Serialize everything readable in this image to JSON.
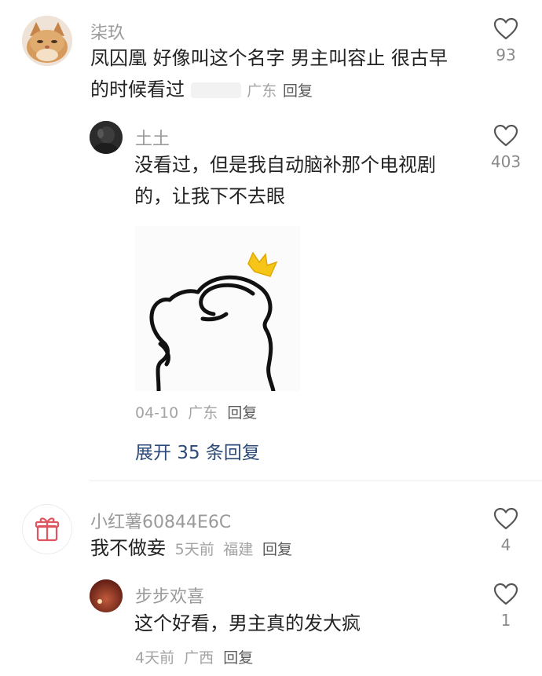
{
  "comments": [
    {
      "username": "柒玖",
      "text_line1": "凤囚凰 好像叫这个名字 男主叫容止 很古早",
      "text_line2": "的时候看过",
      "location": "广东",
      "reply_label": "回复",
      "likes": "93",
      "replies": [
        {
          "username": "土土",
          "text_line1": "没看过，但是我自动脑补那个电视剧",
          "text_line2": "的，让我下不去眼",
          "date": "04-10",
          "location": "广东",
          "reply_label": "回复",
          "likes": "403"
        }
      ],
      "expand_label": "展开 35 条回复"
    },
    {
      "username": "小红薯60844E6C",
      "text": "我不做妾",
      "time": "5天前",
      "location": "福建",
      "reply_label": "回复",
      "likes": "4",
      "replies": [
        {
          "username": "步步欢喜",
          "text": "这个好看，男主真的发大疯",
          "time": "4天前",
          "location": "广西",
          "reply_label": "回复",
          "likes": "1"
        }
      ]
    }
  ],
  "icons": {
    "like": "heart-outline-icon",
    "gift": "gift-icon",
    "sticker": "doodle-sticker"
  },
  "colors": {
    "username": "#9a9a9a",
    "meta": "#a3a3a3",
    "expand": "#2b4a78",
    "sticker_crown": "#f5c518"
  }
}
